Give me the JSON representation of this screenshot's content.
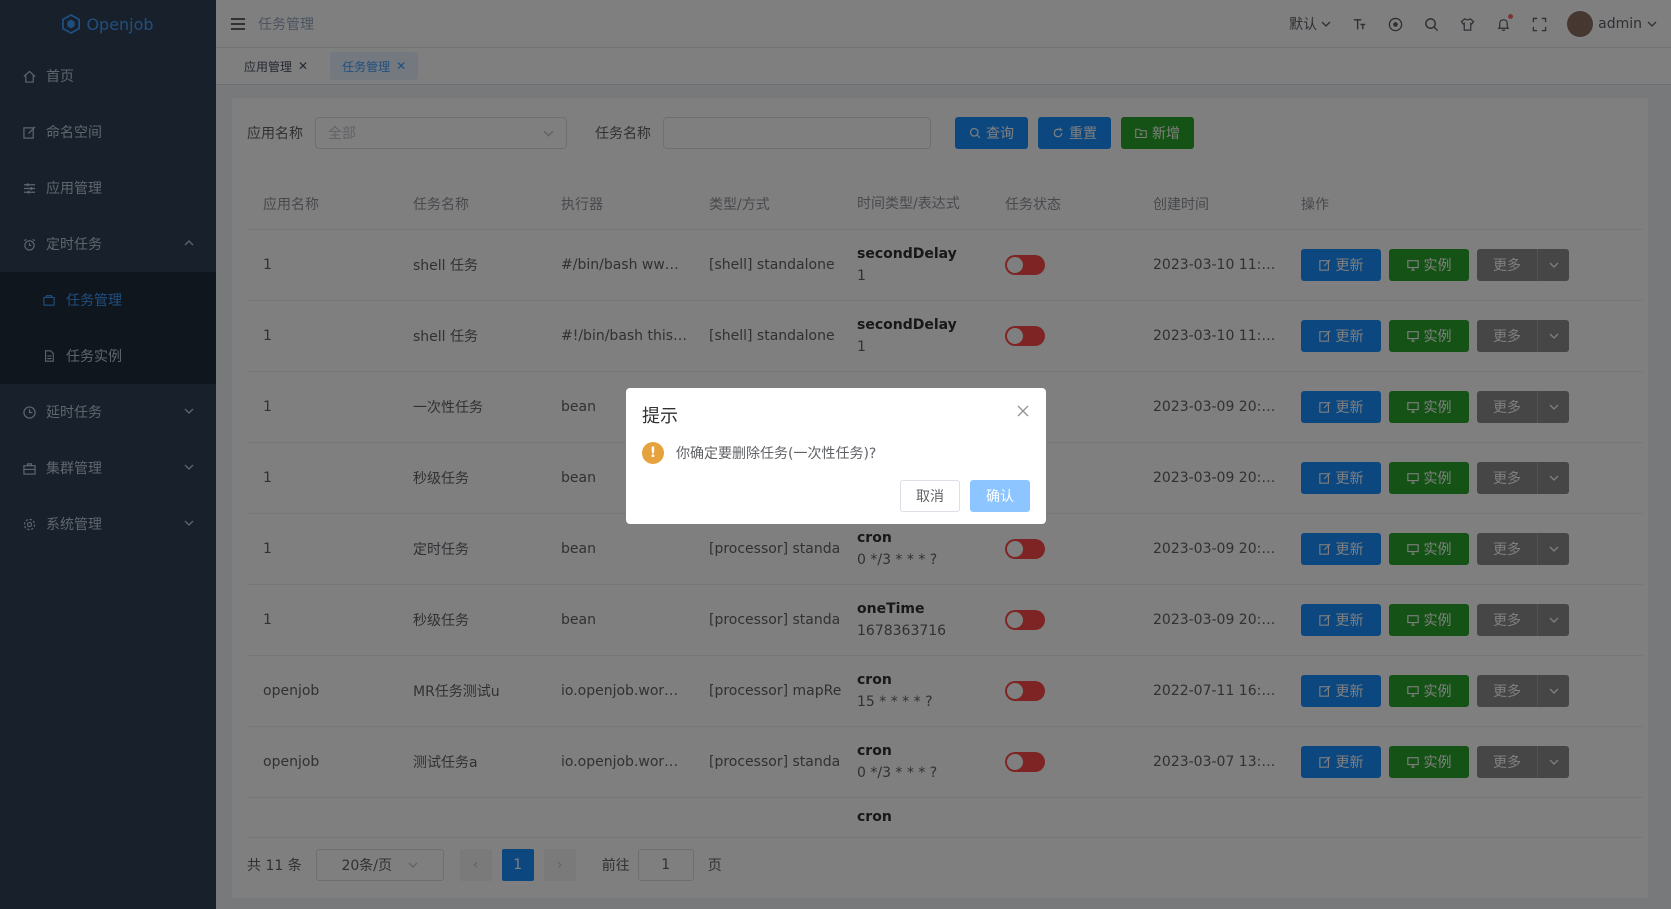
{
  "app": {
    "logo_text": "Openjob"
  },
  "sidebar": {
    "items": [
      {
        "label": "首页",
        "icon": "home-icon"
      },
      {
        "label": "命名空间",
        "icon": "edit-icon"
      },
      {
        "label": "应用管理",
        "icon": "sliders-icon"
      },
      {
        "label": "定时任务",
        "icon": "alarm-clock-icon",
        "expanded": true
      },
      {
        "label": "延时任务",
        "icon": "clock-icon"
      },
      {
        "label": "集群管理",
        "icon": "briefcase-icon"
      },
      {
        "label": "系统管理",
        "icon": "gear-icon"
      }
    ],
    "sub_items": [
      {
        "label": "任务管理",
        "active": true,
        "icon": "box-icon"
      },
      {
        "label": "任务实例",
        "active": false,
        "icon": "document-icon"
      }
    ]
  },
  "header": {
    "breadcrumb": "任务管理",
    "lang": "默认",
    "user": "admin"
  },
  "tags": [
    {
      "label": "应用管理",
      "active": false
    },
    {
      "label": "任务管理",
      "active": true
    }
  ],
  "search": {
    "app_label": "应用名称",
    "app_value": "全部",
    "task_label": "任务名称",
    "task_value": "",
    "query_btn": "查询",
    "reset_btn": "重置",
    "add_btn": "新增"
  },
  "table": {
    "headers": [
      "应用名称",
      "任务名称",
      "执行器",
      "类型/方式",
      "时间类型/表达式",
      "任务状态",
      "创建时间",
      "操作"
    ],
    "rows": [
      {
        "app": "1",
        "name": "shell 任务",
        "executor": "#/bin/bash ww…",
        "type": "[shell] standalone",
        "time_type": "secondDelay",
        "expr": "1",
        "created": "2023-03-10 11:…"
      },
      {
        "app": "1",
        "name": "shell 任务",
        "executor": "#!/bin/bash this…",
        "type": "[shell] standalone",
        "time_type": "secondDelay",
        "expr": "1",
        "created": "2023-03-10 11:…"
      },
      {
        "app": "1",
        "name": "一次性任务",
        "executor": "bean",
        "type": "",
        "time_type": "",
        "expr": "",
        "created": "2023-03-09 20:…"
      },
      {
        "app": "1",
        "name": "秒级任务",
        "executor": "bean",
        "type": "",
        "time_type": "",
        "expr": "",
        "created": "2023-03-09 20:…"
      },
      {
        "app": "1",
        "name": "定时任务",
        "executor": "bean",
        "type": "[processor] standalor",
        "time_type": "cron",
        "expr": "0 */3 * * * ?",
        "created": "2023-03-09 20:…"
      },
      {
        "app": "1",
        "name": "秒级任务",
        "executor": "bean",
        "type": "[processor] standalor",
        "time_type": "oneTime",
        "expr": "1678363716",
        "created": "2023-03-09 20:…"
      },
      {
        "app": "openjob",
        "name": "MR任务测试u",
        "executor": "io.openjob.wor…",
        "type": "[processor] mapRedu",
        "time_type": "cron",
        "expr": "15 * * * * ?",
        "created": "2022-07-11 16:…"
      },
      {
        "app": "openjob",
        "name": "测试任务a",
        "executor": "io.openjob.wor…",
        "type": "[processor] standalor",
        "time_type": "cron",
        "expr": "0 */3 * * * ?",
        "created": "2023-03-07 13:…"
      }
    ],
    "partial_time_type": "cron",
    "update_btn": "更新",
    "instance_btn": "实例",
    "more_btn": "更多"
  },
  "pager": {
    "total": "共 11 条",
    "page_size": "20条/页",
    "current": "1",
    "goto_label": "前往",
    "goto_value": "1",
    "page_suffix": "页"
  },
  "dialog": {
    "title": "提示",
    "message": "你确定要删除任务(一次性任务)?",
    "cancel": "取消",
    "confirm": "确认"
  },
  "colors": {
    "primary": "#1890ff",
    "success": "#2aa52a",
    "danger": "#ff4949",
    "warning": "#e6a23c",
    "sidebar_bg": "#304156"
  }
}
